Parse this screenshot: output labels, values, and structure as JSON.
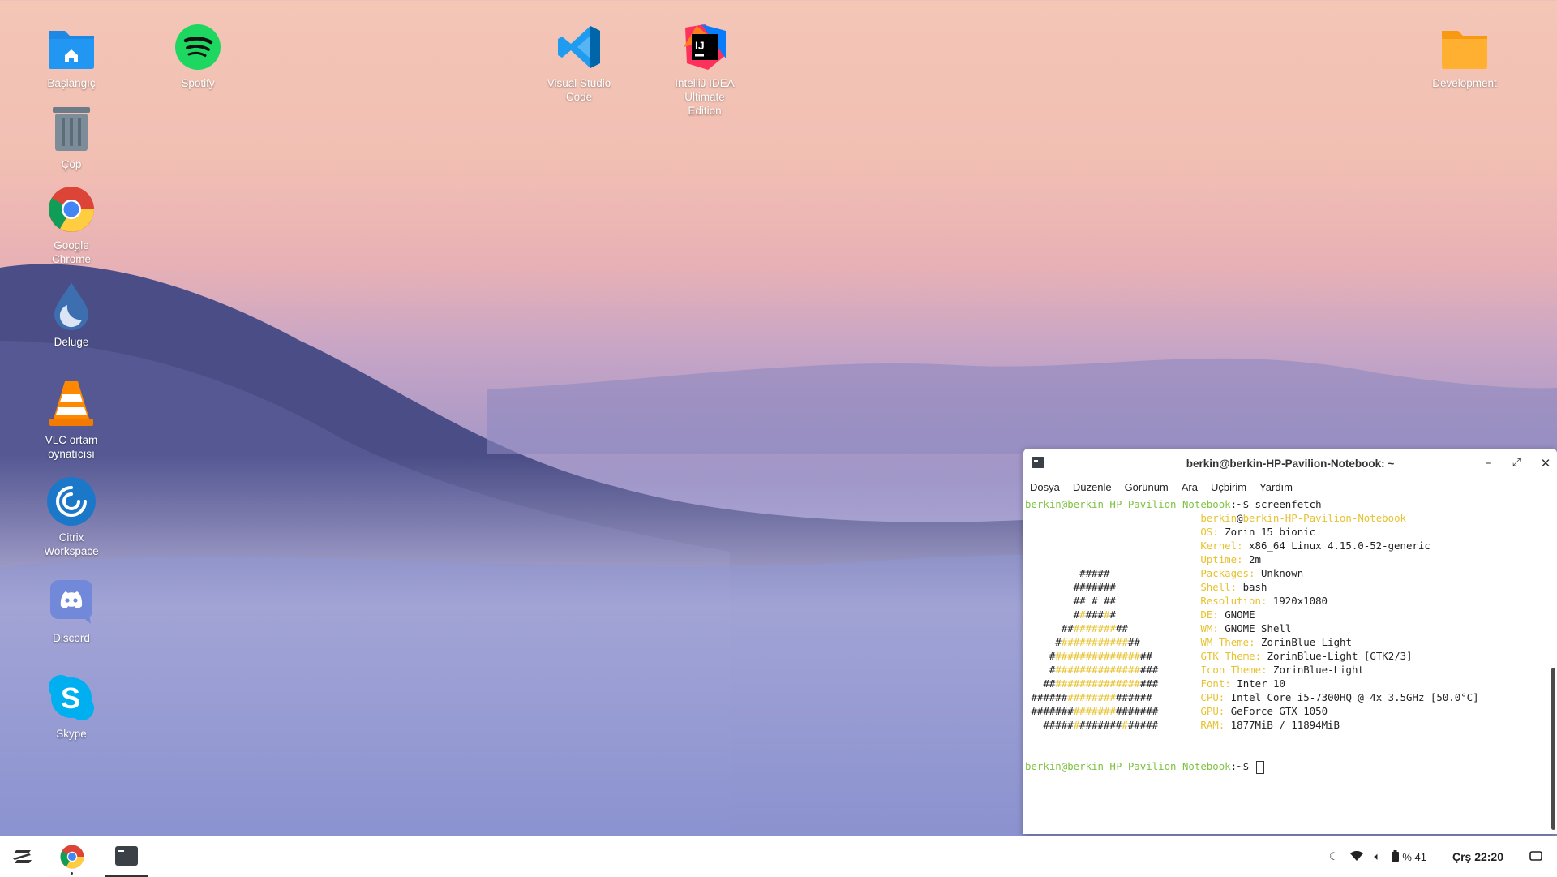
{
  "desktop": {
    "icons": [
      {
        "label": "Başlangıç",
        "icon": "home-folder-icon"
      },
      {
        "label": "Spotify",
        "icon": "spotify-icon"
      },
      {
        "label": "Visual Studio\nCode",
        "icon": "vscode-icon"
      },
      {
        "label": "IntelliJ IDEA\nUltimate\nEdition",
        "icon": "intellij-icon"
      },
      {
        "label": "Development",
        "icon": "folder-icon"
      },
      {
        "label": "Çöp",
        "icon": "trash-icon"
      },
      {
        "label": "Google\nChrome",
        "icon": "chrome-icon"
      },
      {
        "label": "Deluge",
        "icon": "deluge-icon"
      },
      {
        "label": "VLC ortam\noynatıcısı",
        "icon": "vlc-icon"
      },
      {
        "label": "Citrix\nWorkspace",
        "icon": "citrix-icon"
      },
      {
        "label": "Discord",
        "icon": "discord-icon"
      },
      {
        "label": "Skype",
        "icon": "skype-icon"
      }
    ]
  },
  "terminal": {
    "title": "berkin@berkin-HP-Pavilion-Notebook: ~",
    "menu": [
      "Dosya",
      "Düzenle",
      "Görünüm",
      "Ara",
      "Uçbirim",
      "Yardım"
    ],
    "prompt_user": "berkin@berkin-HP-Pavilion-Notebook",
    "prompt_suffix": ":~$ ",
    "command": "screenfetch",
    "header_user": "berkin",
    "header_at": "@",
    "header_host": "berkin-HP-Pavilion-Notebook",
    "info": [
      {
        "key": "OS:",
        "value": " Zorin 15 bionic"
      },
      {
        "key": "Kernel:",
        "value": " x86_64 Linux 4.15.0-52-generic"
      },
      {
        "key": "Uptime:",
        "value": " 2m"
      },
      {
        "key": "Packages:",
        "value": " Unknown"
      },
      {
        "key": "Shell:",
        "value": " bash"
      },
      {
        "key": "Resolution:",
        "value": " 1920x1080"
      },
      {
        "key": "DE:",
        "value": " GNOME"
      },
      {
        "key": "WM:",
        "value": " GNOME Shell"
      },
      {
        "key": "WM Theme:",
        "value": " ZorinBlue-Light"
      },
      {
        "key": "GTK Theme:",
        "value": " ZorinBlue-Light [GTK2/3]"
      },
      {
        "key": "Icon Theme:",
        "value": " ZorinBlue-Light"
      },
      {
        "key": "Font:",
        "value": " Inter 10"
      },
      {
        "key": "CPU:",
        "value": " Intel Core i5-7300HQ @ 4x 3.5GHz [50.0°C]"
      },
      {
        "key": "GPU:",
        "value": " GeForce GTX 1050"
      },
      {
        "key": "RAM:",
        "value": " 1877MiB / 11894MiB"
      }
    ],
    "ascii": [
      "",
      "",
      "",
      "         #####",
      "        #######",
      "        ## # ##",
      "        #:###:#",
      "      ##:::::::##",
      "     #:::::::::::##",
      "    #::::::::::::::##",
      "    #::::::::::::::###",
      "   ##::::::::::::::###",
      " ######::::::::######",
      " #######:::::::#######",
      "   #####:#######:#####"
    ]
  },
  "taskbar": {
    "zorin_menu": "zorin-menu-icon",
    "apps": [
      "chrome-icon",
      "terminal-icon"
    ],
    "battery": "% 41",
    "clock": "Çrş 22:20"
  }
}
